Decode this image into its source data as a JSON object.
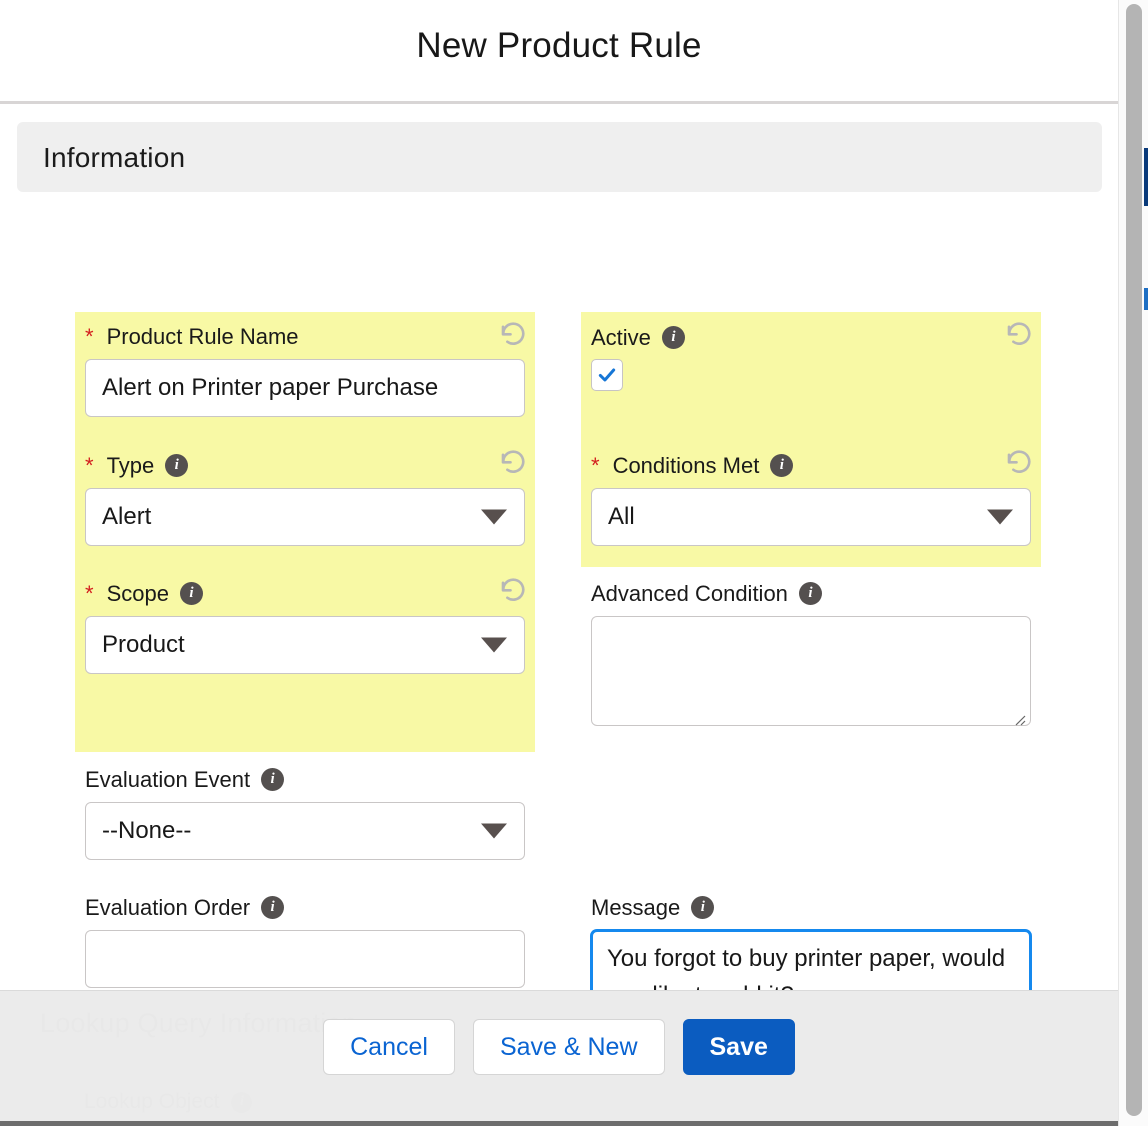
{
  "modal": {
    "title": "New Product Rule",
    "section": {
      "title": "Information"
    }
  },
  "fields": {
    "product_rule_name": {
      "label": "Product Rule Name",
      "required": true,
      "value": "Alert on Printer paper Purchase",
      "placeholder": "",
      "highlighted": true,
      "undo": "undo-icon"
    },
    "type": {
      "label": "Type",
      "required": true,
      "value": "Alert",
      "info": "info-icon",
      "highlighted": true,
      "undo": "undo-icon"
    },
    "scope": {
      "label": "Scope",
      "required": true,
      "value": "Product",
      "info": "info-icon",
      "highlighted": true,
      "undo": "undo-icon"
    },
    "evaluation_event": {
      "label": "Evaluation Event",
      "required": false,
      "value": "--None--",
      "info": "info-icon",
      "highlighted": false
    },
    "evaluation_order": {
      "label": "Evaluation Order",
      "required": false,
      "value": "",
      "placeholder": "",
      "info": "info-icon",
      "highlighted": false
    },
    "active": {
      "label": "Active",
      "required": false,
      "checked": true,
      "info": "info-icon",
      "highlighted": true,
      "undo": "undo-icon"
    },
    "conditions_met": {
      "label": "Conditions Met",
      "required": true,
      "value": "All",
      "info": "info-icon",
      "highlighted": true,
      "undo": "undo-icon"
    },
    "advanced_condition": {
      "label": "Advanced Condition",
      "required": false,
      "value": "",
      "placeholder": "",
      "info": "info-icon",
      "highlighted": false
    },
    "message": {
      "label": "Message",
      "required": false,
      "value": "You forgot to buy printer paper, would you like to add it?",
      "placeholder": "",
      "info": "info-icon",
      "highlighted": false,
      "focused": true
    }
  },
  "footer": {
    "cancel_label": "Cancel",
    "save_new_label": "Save & New",
    "save_label": "Save"
  },
  "background": {
    "section_title": "Lookup Query Information",
    "field_label": "Lookup Object"
  },
  "colors": {
    "highlight": "#f8f9a5",
    "brand_blue": "#0b5cc0",
    "link_blue": "#0a64d2",
    "focus_blue": "#1589ee",
    "required_red": "#d32020",
    "info_icon_gray": "#54504f",
    "section_gray": "#efefef"
  }
}
